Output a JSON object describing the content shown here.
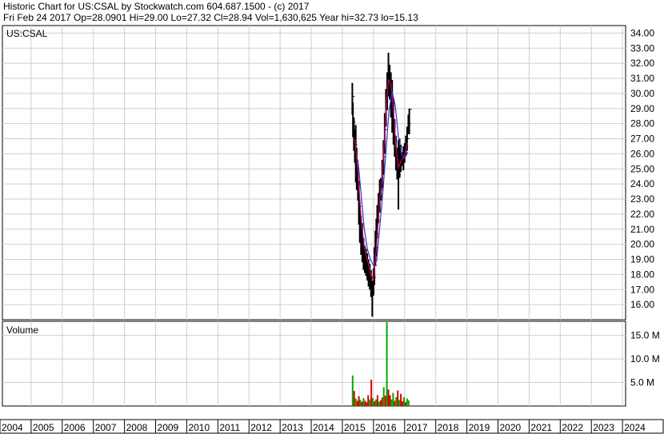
{
  "header": {
    "line1": "Historic Chart for US:CSAL by Stockwatch.com 604.687.1500 - (c) 2017",
    "line2": "Fri Feb 24 2017   Op=28.0901   Hi=29.00   Lo=27.32   Cl=28.94   Vol=1,630,625   Year hi=32.73   lo=15.13"
  },
  "chart_data": {
    "type": "line",
    "title": "",
    "symbol_label": "US:CSAL",
    "volume_label": "Volume",
    "price_axis": {
      "ylim": [
        15,
        34.5
      ],
      "ticks": [
        "16.00",
        "17.00",
        "18.00",
        "19.00",
        "20.00",
        "21.00",
        "22.00",
        "23.00",
        "24.00",
        "25.00",
        "26.00",
        "27.00",
        "28.00",
        "29.00",
        "30.00",
        "31.00",
        "32.00",
        "33.00",
        "34.00"
      ]
    },
    "volume_axis": {
      "ylim": [
        0,
        18
      ],
      "ticks": [
        {
          "v": 5,
          "label": "5.0 M"
        },
        {
          "v": 10,
          "label": "10.0 M"
        },
        {
          "v": 15,
          "label": "15.0 M"
        }
      ]
    },
    "x_axis": {
      "xlim": [
        2004,
        2024.1
      ],
      "years": [
        "2004",
        "2005",
        "2006",
        "2007",
        "2008",
        "2009",
        "2010",
        "2011",
        "2012",
        "2013",
        "2014",
        "2015",
        "2016",
        "2017",
        "2018",
        "2019",
        "2020",
        "2021",
        "2022",
        "2023",
        "2024"
      ]
    },
    "grid": true,
    "series": [
      {
        "style": "price",
        "color": "#000000",
        "x": [
          2015.32,
          2015.34,
          2015.37,
          2015.4,
          2015.43,
          2015.46,
          2015.5,
          2015.53,
          2015.56,
          2015.6,
          2015.64,
          2015.68,
          2015.72,
          2015.76,
          2015.8,
          2015.84,
          2015.88,
          2015.92,
          2015.96,
          2016.0,
          2016.03,
          2016.06,
          2016.09,
          2016.12,
          2016.16,
          2016.2,
          2016.24,
          2016.28,
          2016.32,
          2016.36,
          2016.4,
          2016.44,
          2016.48,
          2016.52,
          2016.56,
          2016.6,
          2016.64,
          2016.68,
          2016.72,
          2016.76,
          2016.8,
          2016.84,
          2016.88,
          2016.92,
          2016.96,
          2017.0,
          2017.04,
          2017.08,
          2017.12,
          2017.15
        ],
        "high": [
          30.7,
          29.4,
          28.4,
          27.6,
          27.9,
          26.4,
          25.3,
          24.2,
          22.8,
          21.9,
          21.4,
          20.4,
          19.9,
          19.7,
          19.4,
          19.0,
          18.7,
          18.3,
          17.6,
          18.4,
          19.8,
          20.9,
          21.7,
          22.6,
          23.4,
          24.3,
          24.4,
          25.6,
          26.9,
          28.7,
          30.3,
          31.4,
          32.7,
          31.9,
          31.4,
          30.9,
          29.7,
          28.3,
          27.2,
          26.4,
          26.9,
          27.0,
          26.6,
          26.1,
          26.5,
          26.7,
          27.2,
          27.8,
          28.6,
          29.0
        ],
        "low": [
          28.6,
          27.1,
          26.2,
          25.4,
          24.1,
          23.6,
          22.9,
          21.3,
          20.1,
          19.3,
          18.8,
          18.3,
          18.1,
          17.9,
          17.6,
          17.2,
          17.0,
          16.5,
          15.2,
          16.6,
          17.3,
          18.6,
          19.2,
          20.4,
          21.4,
          22.1,
          22.9,
          23.7,
          24.6,
          26.0,
          27.8,
          28.9,
          29.8,
          29.6,
          28.4,
          27.4,
          26.6,
          25.8,
          24.9,
          24.3,
          22.3,
          24.4,
          24.8,
          25.2,
          24.9,
          25.4,
          25.9,
          26.2,
          27.3,
          27.3
        ],
        "close": [
          29.8,
          28.1,
          27.2,
          26.6,
          25.6,
          24.9,
          24.1,
          22.5,
          21.3,
          20.5,
          19.9,
          19.3,
          19.1,
          18.8,
          18.7,
          18.2,
          17.9,
          17.7,
          16.9,
          17.8,
          18.6,
          19.8,
          20.7,
          21.6,
          22.3,
          23.2,
          23.6,
          24.9,
          25.8,
          27.6,
          29.5,
          30.6,
          30.9,
          30.6,
          29.9,
          28.9,
          27.8,
          26.9,
          25.8,
          25.1,
          24.6,
          25.3,
          25.9,
          25.6,
          25.8,
          26.0,
          26.5,
          27.0,
          28.0,
          28.94
        ]
      },
      {
        "style": "ma",
        "color": "#cc0066",
        "x": [
          2015.4,
          2015.5,
          2015.6,
          2015.7,
          2015.8,
          2015.9,
          2016.0,
          2016.1,
          2016.2,
          2016.3,
          2016.4,
          2016.48,
          2016.56,
          2016.64,
          2016.72,
          2016.8,
          2016.9,
          2017.0,
          2017.1
        ],
        "values": [
          27.0,
          24.8,
          21.8,
          19.8,
          19.0,
          18.1,
          17.6,
          20.0,
          22.9,
          25.0,
          29.0,
          30.9,
          30.6,
          28.9,
          26.5,
          25.1,
          25.6,
          25.9,
          26.8
        ]
      },
      {
        "style": "ma",
        "color": "#3333cc",
        "x": [
          2015.5,
          2015.6,
          2015.7,
          2015.8,
          2015.9,
          2016.0,
          2016.1,
          2016.2,
          2016.3,
          2016.4,
          2016.5,
          2016.6,
          2016.7,
          2016.8,
          2016.9,
          2017.0,
          2017.1
        ],
        "values": [
          25.6,
          23.4,
          21.1,
          19.7,
          19.0,
          18.6,
          18.9,
          21.1,
          23.4,
          26.1,
          28.9,
          30.1,
          29.2,
          27.1,
          26.0,
          25.7,
          26.1
        ]
      }
    ],
    "volume": {
      "x": [
        2015.33,
        2015.38,
        2015.43,
        2015.48,
        2015.53,
        2015.58,
        2015.63,
        2015.68,
        2015.73,
        2015.78,
        2015.83,
        2015.88,
        2015.93,
        2015.98,
        2016.03,
        2016.08,
        2016.13,
        2016.18,
        2016.23,
        2016.28,
        2016.33,
        2016.38,
        2016.43,
        2016.48,
        2016.53,
        2016.58,
        2016.63,
        2016.68,
        2016.73,
        2016.78,
        2016.83,
        2016.88,
        2016.93,
        2016.98,
        2017.03,
        2017.08,
        2017.13
      ],
      "values": [
        6.5,
        3.2,
        1.6,
        1.1,
        2.1,
        1.3,
        0.9,
        1.7,
        1.1,
        0.8,
        2.3,
        1.4,
        5.6,
        1.7,
        1.0,
        1.4,
        2.3,
        0.9,
        1.2,
        1.8,
        4.0,
        2.2,
        17.8,
        3.5,
        2.3,
        1.4,
        2.8,
        1.1,
        1.9,
        3.3,
        1.3,
        2.6,
        1.0,
        1.9,
        0.8,
        1.6,
        1.2
      ],
      "up": [
        true,
        false,
        true,
        false,
        false,
        true,
        false,
        true,
        false,
        false,
        false,
        true,
        false,
        true,
        false,
        true,
        false,
        true,
        false,
        false,
        true,
        false,
        true,
        false,
        false,
        true,
        true,
        false,
        true,
        false,
        true,
        false,
        false,
        true,
        false,
        true,
        true
      ]
    },
    "volume_colors": {
      "up": "#00aa00",
      "down": "#dd0000"
    }
  }
}
